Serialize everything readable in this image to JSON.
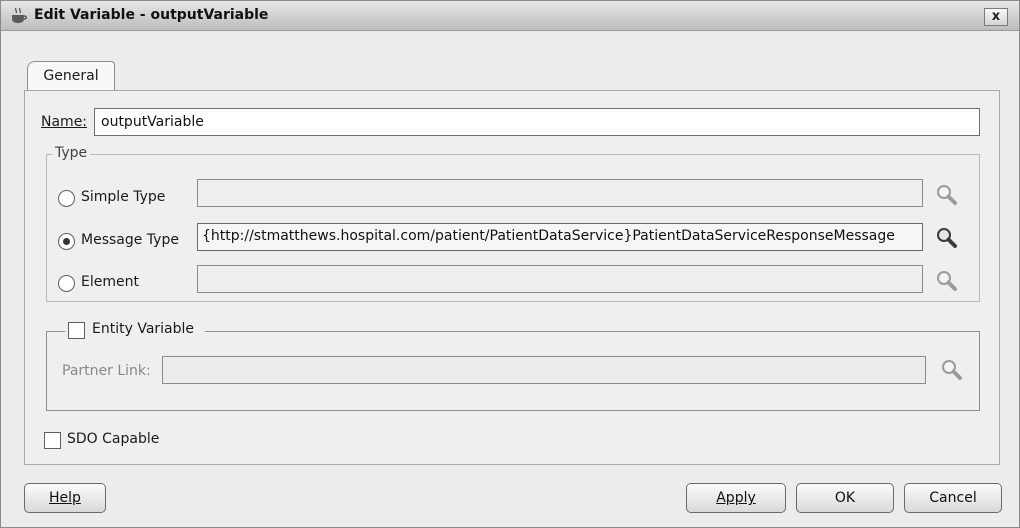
{
  "window": {
    "title": "Edit Variable - outputVariable",
    "close_label": "x"
  },
  "tabs": [
    {
      "label": "General",
      "selected": true
    }
  ],
  "name": {
    "label": "Name:",
    "value": "outputVariable"
  },
  "type_group": {
    "title": "Type",
    "options": [
      {
        "label": "Simple Type",
        "checked": false,
        "value": ""
      },
      {
        "label": "Message Type",
        "checked": true,
        "value": "{http://stmatthews.hospital.com/patient/PatientDataService}PatientDataServiceResponseMessage"
      },
      {
        "label": "Element",
        "checked": false,
        "value": ""
      }
    ]
  },
  "entity": {
    "checkbox_label": "Entity Variable",
    "checked": false,
    "partner_link_label": "Partner Link:",
    "partner_link_value": ""
  },
  "sdo": {
    "label": "SDO Capable",
    "checked": false
  },
  "buttons": {
    "help": "Help",
    "apply": "Apply",
    "ok": "OK",
    "cancel": "Cancel"
  },
  "icons": {
    "title": "coffee-cup-icon",
    "browse": "magnifier-icon"
  }
}
